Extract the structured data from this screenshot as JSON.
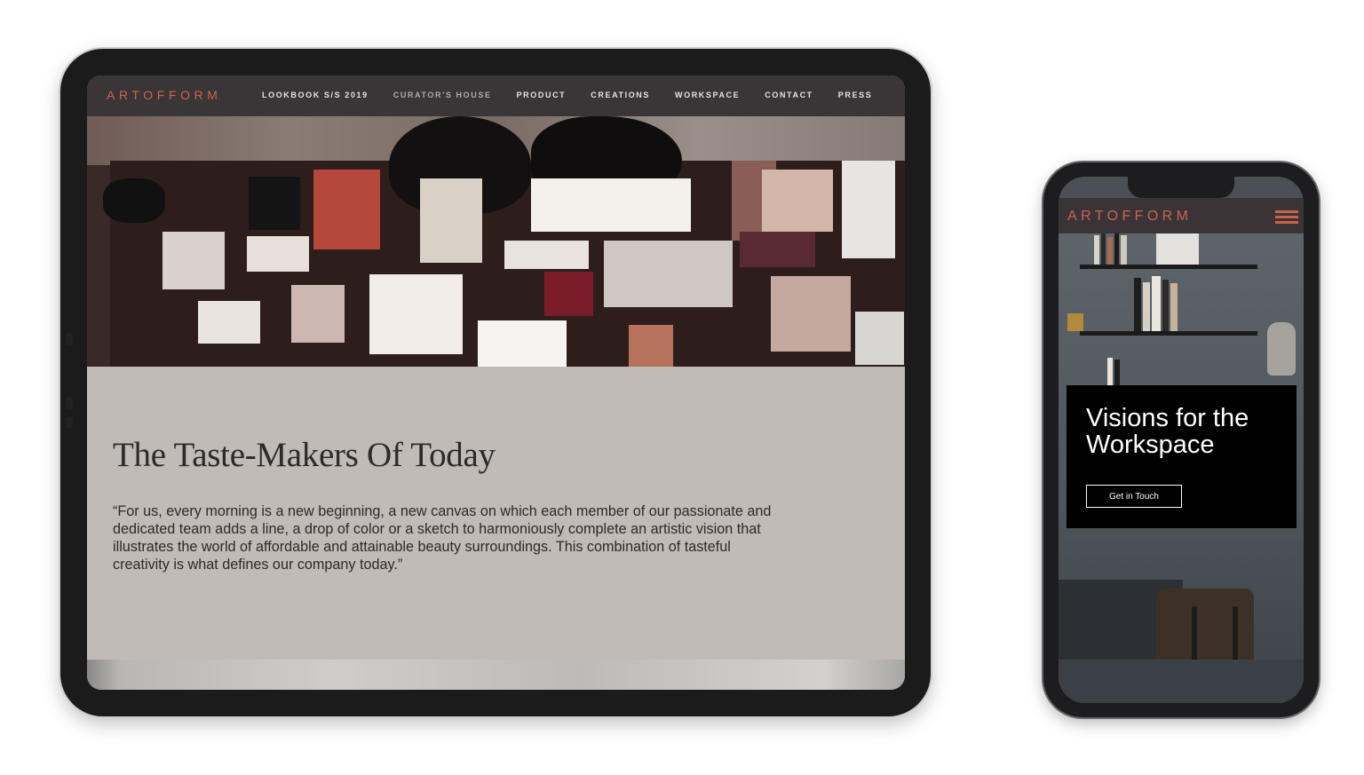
{
  "tablet": {
    "brand": "ARTOFFORM",
    "menu": [
      "LOOKBOOK S/S 2019",
      "CURATOR'S HOUSE",
      "PRODUCT",
      "CREATIONS",
      "WORKSPACE",
      "CONTACT",
      "PRESS"
    ],
    "heading": "The Taste-Makers Of Today",
    "quote": "“For us, every morning is a new beginning, a new canvas on which each member of our passionate and dedicated team adds a line, a drop of color or a sketch to harmoniously complete an artistic vision that illustrates the world of affordable and attainable beauty surroundings. This combination of tasteful creativity is what defines our company today.”"
  },
  "phone": {
    "brand": "ARTOFFORM",
    "headline": "Visions for the Workspace",
    "cta": "Get in Touch"
  },
  "colors": {
    "accent": "#c9654e",
    "nav_bg": "#3a3537",
    "content_bg": "#c1bbb7"
  }
}
